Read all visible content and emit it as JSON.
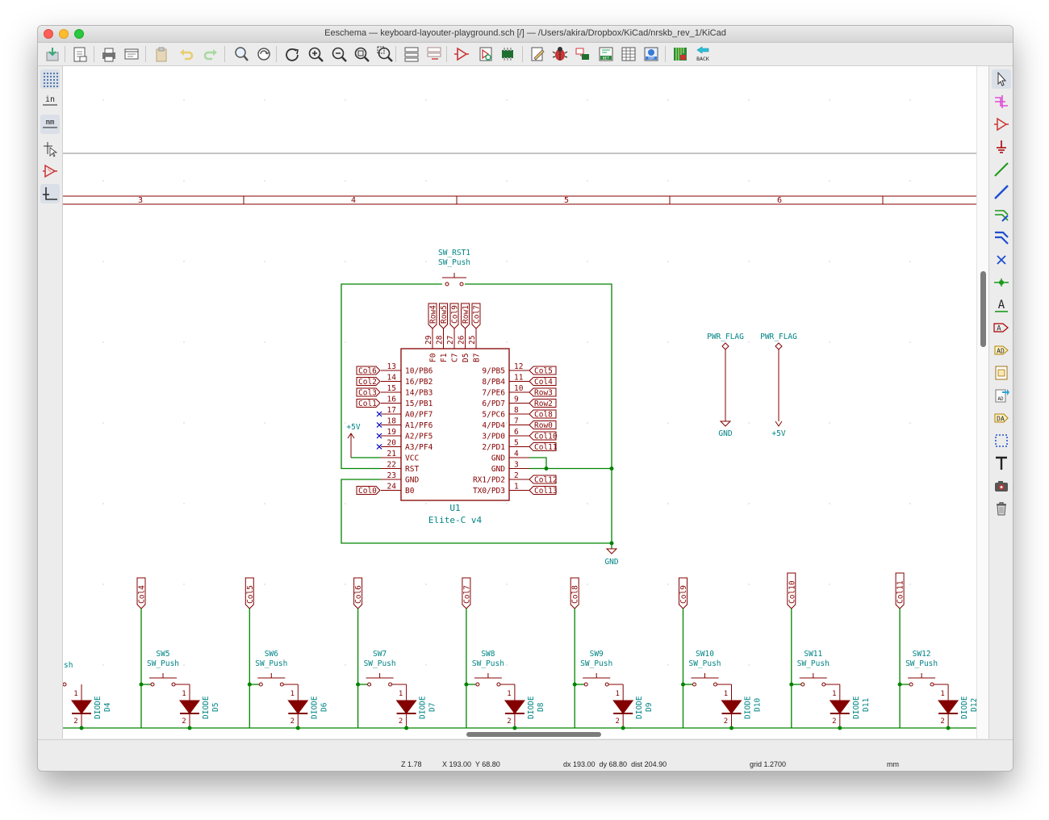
{
  "window": {
    "title": "Eeschema — keyboard-layouter-playground.sch [/] — /Users/akira/Dropbox/KiCad/nrskb_rev_1/KiCad"
  },
  "toolbar": {
    "icons": [
      "save-icon",
      "page-settings-icon",
      "print-icon",
      "plot-icon",
      "paste-icon",
      "undo-icon",
      "redo-icon",
      "find-icon",
      "find-replace-icon",
      "redraw-icon",
      "zoom-in-icon",
      "zoom-out-icon",
      "zoom-fit-icon",
      "zoom-selection-icon",
      "hierarchy-icon",
      "leave-sheet-icon",
      "symbol-editor-icon",
      "symbol-browser-icon",
      "footprint-editor-icon",
      "annotate-icon",
      "erc-icon",
      "assign-footprints-icon",
      "netlist-icon",
      "bom-table-icon",
      "bom-icon",
      "pcbnew-icon",
      "back-icon"
    ],
    "back_label": "BACK",
    "netlist_label": "NET",
    "bom_label": "BOM"
  },
  "left_toolbar": {
    "inch_label": "in",
    "mm_label": "mm"
  },
  "schematic": {
    "border_columns": [
      "3",
      "4",
      "5",
      "6"
    ],
    "reset_switch": {
      "ref": "SW_RST1",
      "value": "SW_Push"
    },
    "mcu": {
      "ref": "U1",
      "value": "Elite-C v4",
      "top_pins": [
        {
          "num": "29",
          "name": "F0",
          "label": "Row4"
        },
        {
          "num": "28",
          "name": "F1",
          "label": "Row5"
        },
        {
          "num": "27",
          "name": "C7",
          "label": "Col9"
        },
        {
          "num": "26",
          "name": "D5",
          "label": "Row1"
        },
        {
          "num": "25",
          "name": "B7",
          "label": "Col7"
        }
      ],
      "left_pins": [
        {
          "num": "13",
          "name": "10/PB6",
          "label": "Col6"
        },
        {
          "num": "14",
          "name": "16/PB2",
          "label": "Col2"
        },
        {
          "num": "15",
          "name": "14/PB3",
          "label": "Col3"
        },
        {
          "num": "16",
          "name": "15/PB1",
          "label": "Col1"
        },
        {
          "num": "17",
          "name": "A0/PF7",
          "label": ""
        },
        {
          "num": "18",
          "name": "A1/PF6",
          "label": ""
        },
        {
          "num": "19",
          "name": "A2/PF5",
          "label": ""
        },
        {
          "num": "20",
          "name": "A3/PF4",
          "label": ""
        },
        {
          "num": "21",
          "name": "VCC",
          "label": ""
        },
        {
          "num": "22",
          "name": "RST",
          "label": ""
        },
        {
          "num": "23",
          "name": "GND",
          "label": ""
        },
        {
          "num": "24",
          "name": "B0",
          "label": "Col0"
        }
      ],
      "right_pins": [
        {
          "num": "12",
          "name": "9/PB5",
          "label": "Col5"
        },
        {
          "num": "11",
          "name": "8/PB4",
          "label": "Col4"
        },
        {
          "num": "10",
          "name": "7/PE6",
          "label": "Row3"
        },
        {
          "num": "9",
          "name": "6/PD7",
          "label": "Row2"
        },
        {
          "num": "8",
          "name": "5/PC6",
          "label": "Col8"
        },
        {
          "num": "7",
          "name": "4/PD4",
          "label": "Row0"
        },
        {
          "num": "6",
          "name": "3/PD0",
          "label": "Col10"
        },
        {
          "num": "5",
          "name": "2/PD1",
          "label": "Col11"
        },
        {
          "num": "4",
          "name": "GND",
          "label": ""
        },
        {
          "num": "3",
          "name": "GND",
          "label": ""
        },
        {
          "num": "2",
          "name": "RX1/PD2",
          "label": "Col12"
        },
        {
          "num": "1",
          "name": "TX0/PD3",
          "label": "Col13"
        }
      ]
    },
    "power": {
      "plus5v": "+5V",
      "gnd": "GND",
      "pwr_flag": "PWR_FLAG"
    },
    "partial_switch_value": "sh",
    "switches": [
      {
        "ref": "SW5",
        "value": "SW_Push",
        "col": "Col4",
        "diode": "D5",
        "diode_value": "DIODE"
      },
      {
        "ref": "SW6",
        "value": "SW_Push",
        "col": "Col5",
        "diode": "D6",
        "diode_value": "DIODE"
      },
      {
        "ref": "SW7",
        "value": "SW_Push",
        "col": "Col6",
        "diode": "D7",
        "diode_value": "DIODE"
      },
      {
        "ref": "SW8",
        "value": "SW_Push",
        "col": "Col7",
        "diode": "D8",
        "diode_value": "DIODE"
      },
      {
        "ref": "SW9",
        "value": "SW_Push",
        "col": "Col8",
        "diode": "D9",
        "diode_value": "DIODE"
      },
      {
        "ref": "SW10",
        "value": "SW_Push",
        "col": "Col9",
        "diode": "D10",
        "diode_value": "DIODE"
      },
      {
        "ref": "SW11",
        "value": "SW_Push",
        "col": "Col10",
        "diode": "D11",
        "diode_value": "DIODE"
      },
      {
        "ref": "SW12",
        "value": "SW_Push",
        "col": "Col11",
        "diode": "D12",
        "diode_value": "DIODE"
      }
    ],
    "first_diode": {
      "ref": "D4",
      "value": "DIODE"
    },
    "diode_pin_anode": "1",
    "diode_pin_cathode": "2"
  },
  "statusbar": {
    "zoom": "Z 1.78",
    "xy": "X 193.00  Y 68.80",
    "delta": "dx 193.00  dy 68.80  dist 204.90",
    "grid": "grid 1.2700",
    "units": "mm"
  },
  "colors": {
    "symbol": "#840000",
    "wire": "#008400",
    "text": "#008484",
    "noconnect": "#0000c2",
    "border": "#840000"
  }
}
